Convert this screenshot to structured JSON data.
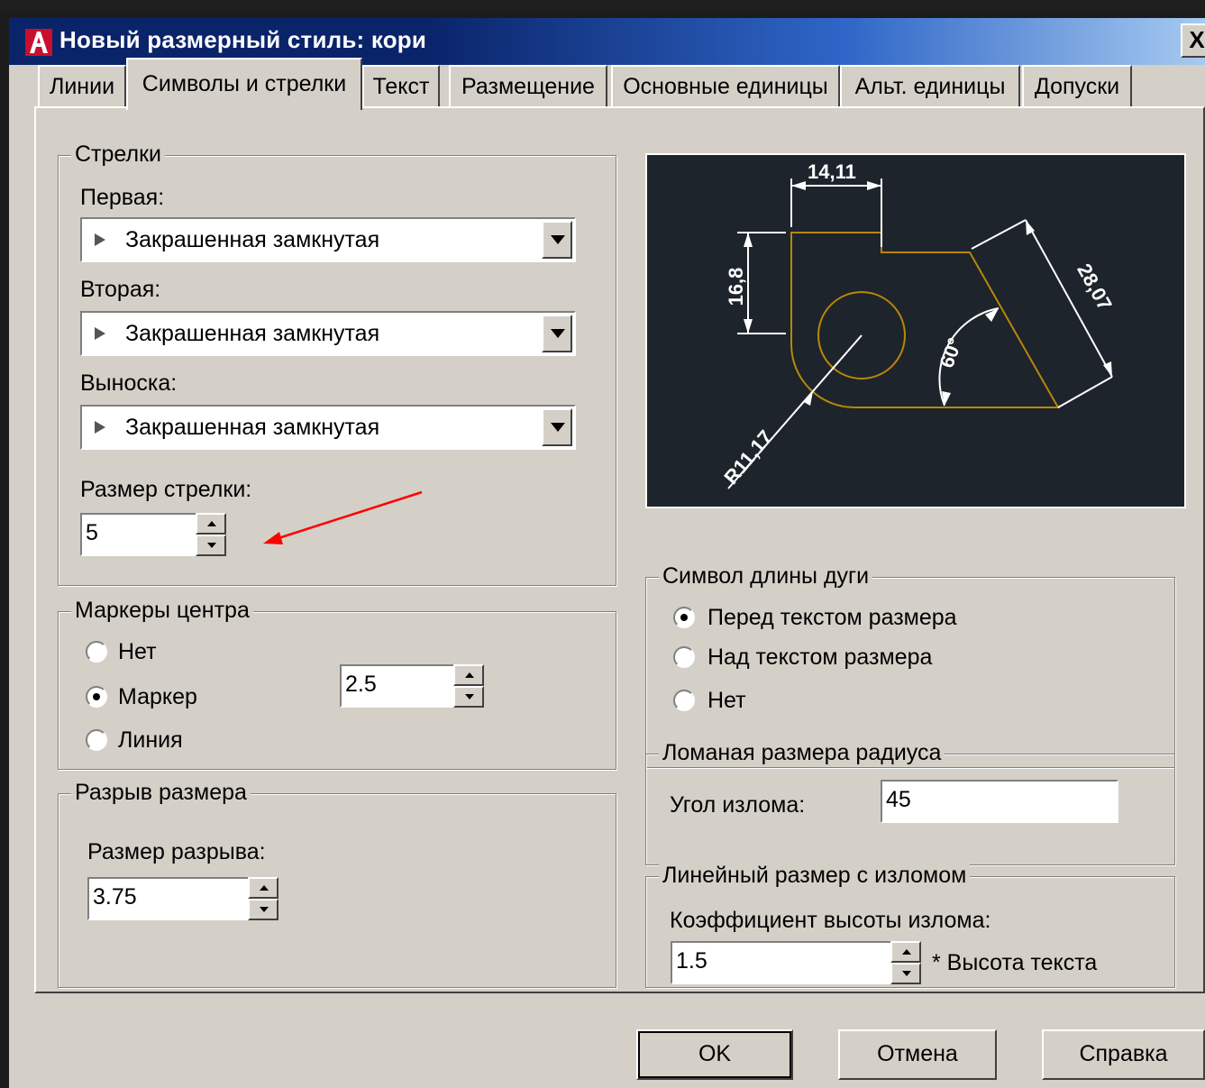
{
  "window": {
    "title": "Новый размерный стиль: кори",
    "close_label": "X"
  },
  "tabs": [
    {
      "label": "Линии"
    },
    {
      "label": "Символы и стрелки"
    },
    {
      "label": "Текст"
    },
    {
      "label": "Размещение"
    },
    {
      "label": "Основные единицы"
    },
    {
      "label": "Альт. единицы"
    },
    {
      "label": "Допуски"
    }
  ],
  "arrows": {
    "legend": "Стрелки",
    "first_label": "Первая:",
    "first_value": "Закрашенная замкнутая",
    "second_label": "Вторая:",
    "second_value": "Закрашенная замкнутая",
    "leader_label": "Выноска:",
    "leader_value": "Закрашенная замкнутая",
    "size_label": "Размер стрелки:",
    "size_value": "5"
  },
  "center_marks": {
    "legend": "Маркеры центра",
    "options": [
      "Нет",
      "Маркер",
      "Линия"
    ],
    "selected": "Маркер",
    "size_value": "2.5"
  },
  "dim_break": {
    "legend": "Разрыв размера",
    "size_label": "Размер разрыва:",
    "size_value": "3.75"
  },
  "preview": {
    "dim_top": "14,11",
    "dim_left": "16,8",
    "dim_diag": "28,07",
    "dim_angle": "60°",
    "dim_radius": "R11,17",
    "colors": {
      "background": "#1e242b",
      "geometry": "#b8860b",
      "dimension": "#ffffff"
    }
  },
  "arc_symbol": {
    "legend": "Символ длины дуги",
    "options": [
      "Перед текстом размера",
      "Над текстом размера",
      "Нет"
    ],
    "selected": "Перед текстом размера"
  },
  "radius_jog": {
    "legend": "Ломаная размера радиуса",
    "angle_label": "Угол излома:",
    "angle_value": "45"
  },
  "linear_jog": {
    "legend": "Линейный размер с изломом",
    "factor_label": "Коэффициент высоты излома:",
    "factor_value": "1.5",
    "suffix": "* Высота текста"
  },
  "buttons": {
    "ok": "OK",
    "cancel": "Отмена",
    "help": "Справка"
  },
  "annotation": {
    "color": "#ff0000"
  }
}
